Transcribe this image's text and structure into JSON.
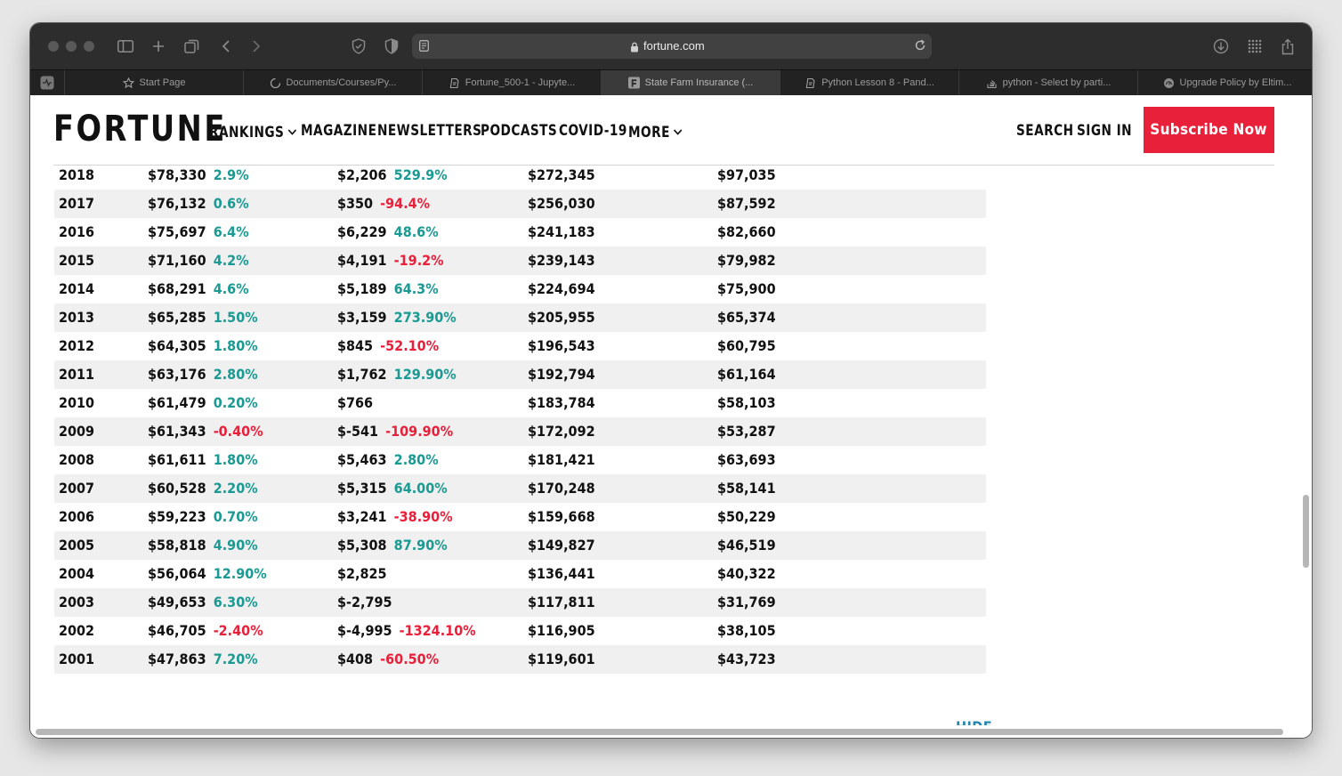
{
  "browser": {
    "url": "fortune.com",
    "tabs": [
      {
        "label": "Start Page",
        "icon": "star-icon",
        "active": false
      },
      {
        "label": "Documents/Courses/Py...",
        "icon": "spinner-icon",
        "active": false
      },
      {
        "label": "Fortune_500-1 - Jupyte...",
        "icon": "page-icon",
        "active": false
      },
      {
        "label": "State Farm Insurance (...",
        "icon": "fortune-favicon-icon",
        "active": true
      },
      {
        "label": "Python Lesson 8 - Pand...",
        "icon": "page-icon",
        "active": false
      },
      {
        "label": "python - Select by parti...",
        "icon": "stack-icon",
        "active": false
      },
      {
        "label": "Upgrade Policy by Eltim...",
        "icon": "gauge-icon",
        "active": false
      }
    ]
  },
  "nav": {
    "logo": "FORTUNE",
    "items": [
      "RANKINGS",
      "MAGAZINE",
      "NEWSLETTERS",
      "PODCASTS",
      "COVID-19",
      "MORE"
    ],
    "search": "SEARCH",
    "signin": "SIGN IN",
    "subscribe": "Subscribe Now"
  },
  "table": {
    "rows": [
      {
        "year": "2018",
        "revenue": "$78,330",
        "revenue_change": "2.9%",
        "profit": "$2,206",
        "profit_change": "529.9%",
        "assets": "$272,345",
        "equity": "$97,035"
      },
      {
        "year": "2017",
        "revenue": "$76,132",
        "revenue_change": "0.6%",
        "profit": "$350",
        "profit_change": "-94.4%",
        "assets": "$256,030",
        "equity": "$87,592"
      },
      {
        "year": "2016",
        "revenue": "$75,697",
        "revenue_change": "6.4%",
        "profit": "$6,229",
        "profit_change": "48.6%",
        "assets": "$241,183",
        "equity": "$82,660"
      },
      {
        "year": "2015",
        "revenue": "$71,160",
        "revenue_change": "4.2%",
        "profit": "$4,191",
        "profit_change": "-19.2%",
        "assets": "$239,143",
        "equity": "$79,982"
      },
      {
        "year": "2014",
        "revenue": "$68,291",
        "revenue_change": "4.6%",
        "profit": "$5,189",
        "profit_change": "64.3%",
        "assets": "$224,694",
        "equity": "$75,900"
      },
      {
        "year": "2013",
        "revenue": "$65,285",
        "revenue_change": "1.50%",
        "profit": "$3,159",
        "profit_change": "273.90%",
        "assets": "$205,955",
        "equity": "$65,374"
      },
      {
        "year": "2012",
        "revenue": "$64,305",
        "revenue_change": "1.80%",
        "profit": "$845",
        "profit_change": "-52.10%",
        "assets": "$196,543",
        "equity": "$60,795"
      },
      {
        "year": "2011",
        "revenue": "$63,176",
        "revenue_change": "2.80%",
        "profit": "$1,762",
        "profit_change": "129.90%",
        "assets": "$192,794",
        "equity": "$61,164"
      },
      {
        "year": "2010",
        "revenue": "$61,479",
        "revenue_change": "0.20%",
        "profit": "$766",
        "profit_change": "",
        "assets": "$183,784",
        "equity": "$58,103"
      },
      {
        "year": "2009",
        "revenue": "$61,343",
        "revenue_change": "-0.40%",
        "profit": "$-541",
        "profit_change": "-109.90%",
        "assets": "$172,092",
        "equity": "$53,287"
      },
      {
        "year": "2008",
        "revenue": "$61,611",
        "revenue_change": "1.80%",
        "profit": "$5,463",
        "profit_change": "2.80%",
        "assets": "$181,421",
        "equity": "$63,693"
      },
      {
        "year": "2007",
        "revenue": "$60,528",
        "revenue_change": "2.20%",
        "profit": "$5,315",
        "profit_change": "64.00%",
        "assets": "$170,248",
        "equity": "$58,141"
      },
      {
        "year": "2006",
        "revenue": "$59,223",
        "revenue_change": "0.70%",
        "profit": "$3,241",
        "profit_change": "-38.90%",
        "assets": "$159,668",
        "equity": "$50,229"
      },
      {
        "year": "2005",
        "revenue": "$58,818",
        "revenue_change": "4.90%",
        "profit": "$5,308",
        "profit_change": "87.90%",
        "assets": "$149,827",
        "equity": "$46,519"
      },
      {
        "year": "2004",
        "revenue": "$56,064",
        "revenue_change": "12.90%",
        "profit": "$2,825",
        "profit_change": "",
        "assets": "$136,441",
        "equity": "$40,322"
      },
      {
        "year": "2003",
        "revenue": "$49,653",
        "revenue_change": "6.30%",
        "profit": "$-2,795",
        "profit_change": "",
        "assets": "$117,811",
        "equity": "$31,769"
      },
      {
        "year": "2002",
        "revenue": "$46,705",
        "revenue_change": "-2.40%",
        "profit": "$-4,995",
        "profit_change": "-1324.10%",
        "assets": "$116,905",
        "equity": "$38,105"
      },
      {
        "year": "2001",
        "revenue": "$47,863",
        "revenue_change": "7.20%",
        "profit": "$408",
        "profit_change": "-60.50%",
        "assets": "$119,601",
        "equity": "$43,723"
      }
    ],
    "hide_label": "HIDE"
  },
  "colors": {
    "positive": "#1a9a93",
    "negative": "#e8203a",
    "brand_red": "#e8203a",
    "link": "#2387ae"
  }
}
